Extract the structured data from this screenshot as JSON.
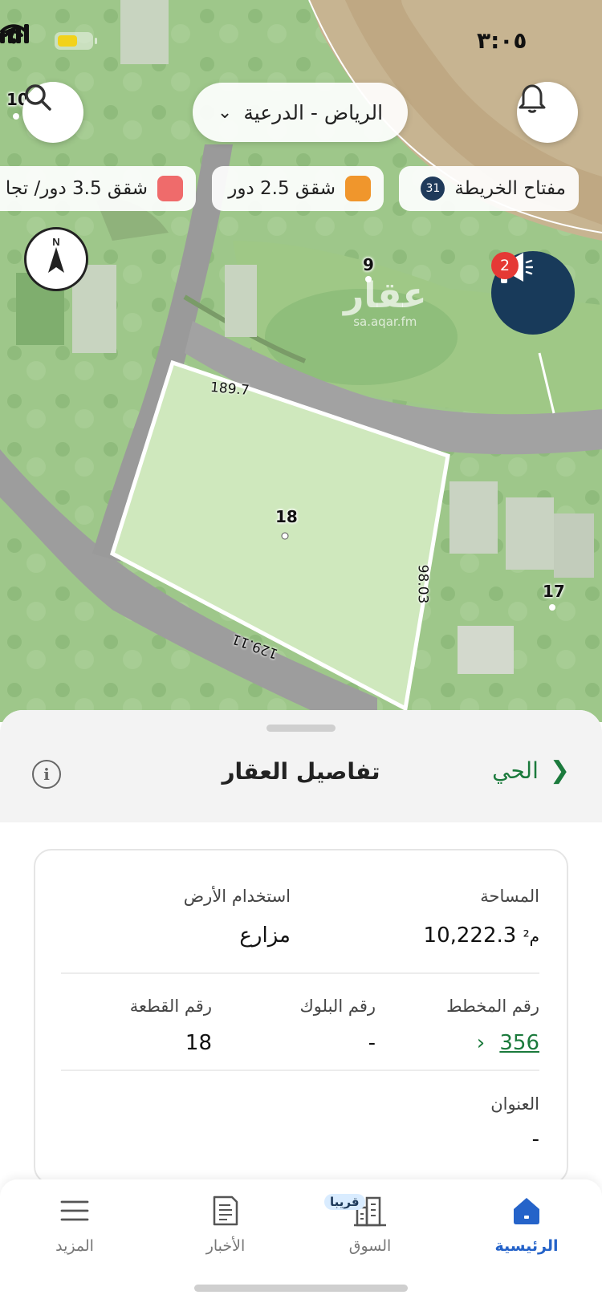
{
  "status_bar": {
    "time": "٣:٠٥"
  },
  "map": {
    "city_selector": "الرياض - الدرعية",
    "map_key": {
      "label": "مفتاح الخريطة",
      "count": "31"
    },
    "legend": [
      {
        "label": "شقق 2.5 دور",
        "color": "#f0962c"
      },
      {
        "label": "شقق 3.5 دور/ تجا",
        "color": "#ef6b6b"
      }
    ],
    "compass": "N",
    "promo_badge": "2",
    "watermark": {
      "logo": "عقار",
      "url": "sa.aqar.fm"
    },
    "plot_labels": {
      "main": "18",
      "p9": "9",
      "p10": "10",
      "p17": "17"
    },
    "dimensions": {
      "top": "189.7",
      "right": "98.03",
      "bottom": "129.11"
    },
    "colors": {
      "highlight": "#cfe8bd",
      "accent": "#1b7a3c"
    }
  },
  "sheet": {
    "title": "تفاصيل العقار",
    "neighborhood_link": "الحي",
    "details": {
      "area_label": "المساحة",
      "area_value": "10,222.3",
      "area_unit": "م²",
      "land_use_label": "استخدام الأرض",
      "land_use_value": "مزارع",
      "plan_label": "رقم المخطط",
      "plan_value": "356",
      "block_label": "رقم البلوك",
      "block_value": "-",
      "plot_label": "رقم القطعة",
      "plot_value": "18",
      "address_label": "العنوان",
      "address_value": "-"
    }
  },
  "tabbar": {
    "home": "الرئيسية",
    "market": "السوق",
    "soon_badge": "قريبا",
    "news": "الأخبار",
    "more": "المزيد"
  }
}
